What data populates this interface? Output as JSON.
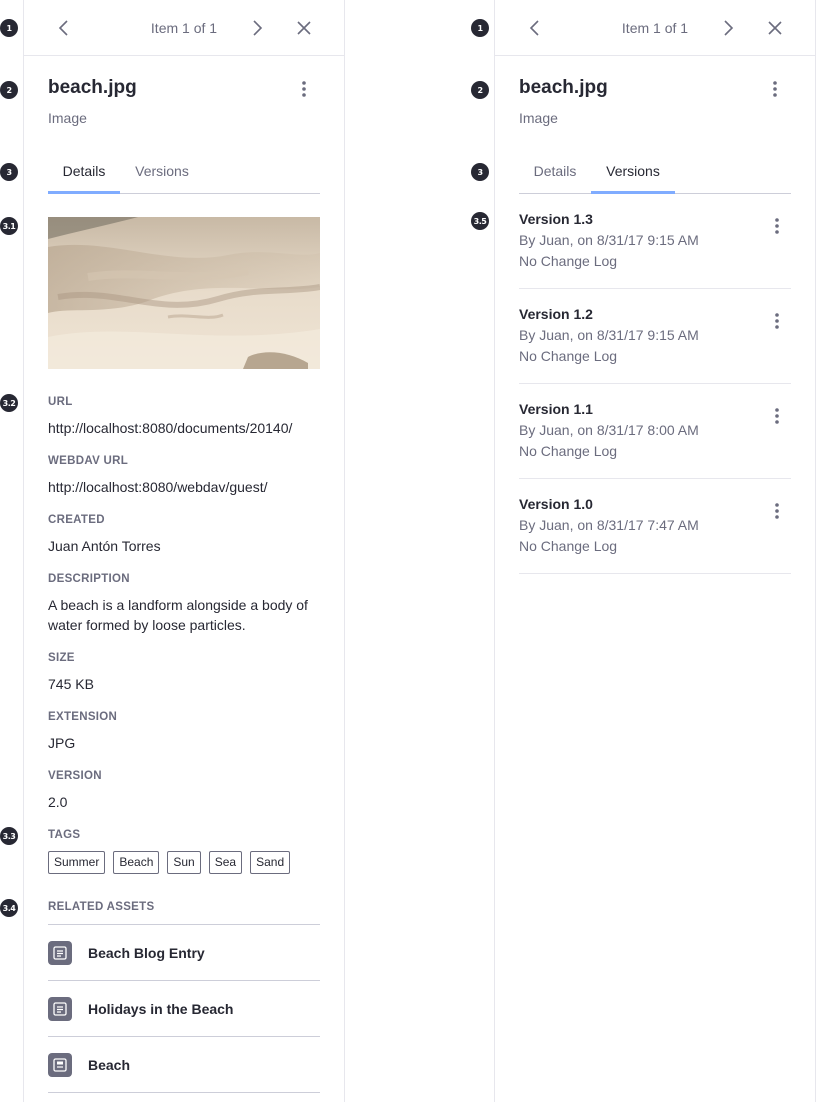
{
  "markers": {
    "m1": "1",
    "m2": "2",
    "m3": "3",
    "m31": "3.1",
    "m32": "3.2",
    "m33": "3.3",
    "m34": "3.4",
    "m35": "3.5"
  },
  "left_panel": {
    "nav": {
      "count": "Item 1 of 1"
    },
    "title": "beach.jpg",
    "subtitle": "Image",
    "tabs": [
      "Details",
      "Versions"
    ],
    "active_tab": "Details",
    "fields": {
      "url_label": "URL",
      "url_value": "http://localhost:8080/documents/20140/",
      "webdav_label": "WEBDAV URL",
      "webdav_value": "http://localhost:8080/webdav/guest/",
      "created_label": "CREATED",
      "created_value": "Juan Antón Torres",
      "description_label": "DESCRIPTION",
      "description_value": "A beach is a landform alongside a body of water formed by loose particles.",
      "size_label": "SIZE",
      "size_value": "745 KB",
      "extension_label": "EXTENSION",
      "extension_value": "JPG",
      "version_label": "VERSION",
      "version_value": "2.0",
      "tags_label": "TAGS",
      "related_label": "RELATED ASSETS"
    },
    "tags": [
      "Summer",
      "Beach",
      "Sun",
      "Sea",
      "Sand"
    ],
    "related_assets": [
      {
        "label": "Beach Blog Entry",
        "icon": "web-content-icon"
      },
      {
        "label": "Holidays in the Beach",
        "icon": "web-content-icon"
      },
      {
        "label": "Beach",
        "icon": "document-icon"
      }
    ]
  },
  "right_panel": {
    "nav": {
      "count": "Item 1 of 1"
    },
    "title": "beach.jpg",
    "subtitle": "Image",
    "tabs": [
      "Details",
      "Versions"
    ],
    "active_tab": "Versions",
    "versions": [
      {
        "name": "Version 1.3",
        "by": "By Juan, on 8/31/17 9:15 AM",
        "log": "No Change Log"
      },
      {
        "name": "Version 1.2",
        "by": "By Juan, on 8/31/17 9:15 AM",
        "log": "No Change Log"
      },
      {
        "name": "Version 1.1",
        "by": "By Juan, on 8/31/17 8:00 AM",
        "log": "No Change Log"
      },
      {
        "name": "Version 1.0",
        "by": "By Juan, on 8/31/17 7:47 AM",
        "log": "No Change Log"
      }
    ]
  },
  "colors": {
    "accent": "#80acff",
    "text": "#272833",
    "muted": "#6b6c7e",
    "border": "#e7e7ed"
  }
}
